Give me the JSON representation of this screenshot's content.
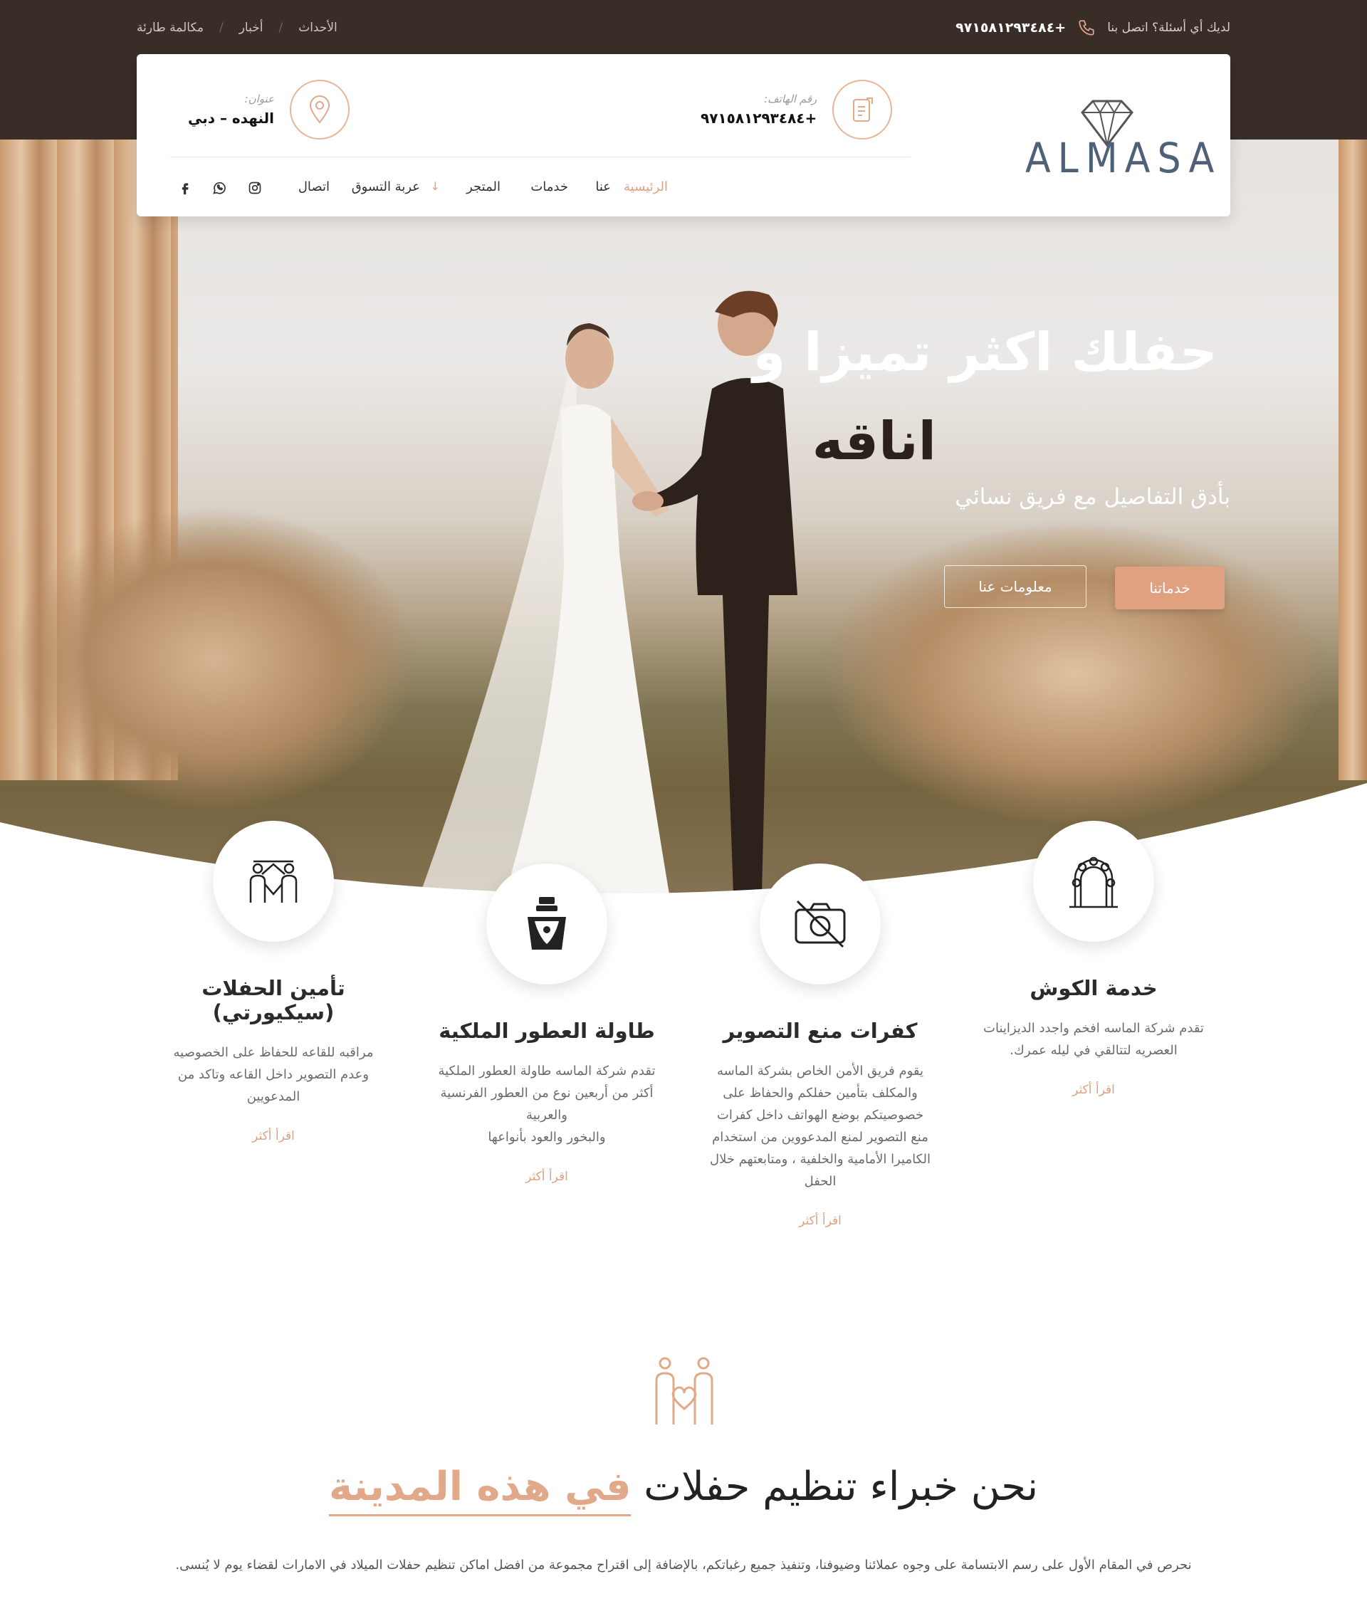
{
  "topbar": {
    "contact_label": "لديك أي أسئلة؟ اتصل بنا",
    "phone": "+٩٧١٥٨١٢٩٣٤٨٤",
    "links": [
      "الأحداث",
      "أخبار",
      "مكالمة طارئة"
    ]
  },
  "header": {
    "brand": "ALMASA",
    "phone_label": "رقم الهاتف:",
    "phone": "+٩٧١٥٨١٢٩٣٤٨٤",
    "address_label": "عنوان:",
    "address": "النهده – دبي",
    "nav": [
      "الرئيسية",
      "عنا",
      "خدمات",
      "المتجر",
      "عربة التسوق",
      "اتصال"
    ],
    "social_icons": [
      "instagram-icon",
      "whatsapp-icon",
      "facebook-icon"
    ]
  },
  "hero": {
    "title_line1": "حفلك اكثر تميزا و",
    "title_line2": "اناقه",
    "subtitle": "بأدق التفاصيل مع فريق نسائي",
    "primary_button": "خدماتنا",
    "secondary_button": "معلومات عنا"
  },
  "services": [
    {
      "title": "خدمة الكوش",
      "text": "تقدم شركة الماسه افخم واجدد الديزاينات\nالعصريه لتتالقي في ليله عمرك.",
      "link": "اقرأ أكثر"
    },
    {
      "title": "كفرات منع التصوير",
      "text": "يقوم فريق الأمن الخاص بشركة الماسه\nوالمكلف بتأمين حفلكم والحفاظ على\nخصوصيتكم بوضع الهواتف داخل كفرات\nمنع التصوير لمنع المدعووين من استخدام\nالكاميرا الأمامية والخلفية ، ومتابعتهم خلال\nالحفل",
      "link": "اقرأ أكثر"
    },
    {
      "title": "طاولة العطور الملكية",
      "text": "تقدم شركة الماسه طاولة العطور الملكية\nأكثر من أربعين نوع من العطور الفرنسية\nوالعربية\nوالبخور والعود بأنواعها",
      "link": "اقرأ أكثر"
    },
    {
      "title": "تأمين الحفلات (سيكيورتي)",
      "text": "مراقبه للقاعه للحفاظ على الخصوصيه\nوعدم التصوير داخل القاعه وتاكد من\nالمدعويين",
      "link": "اقرأ أكثر"
    }
  ],
  "about": {
    "title_plain": "نحن خبراء تنظيم حفلات ",
    "title_highlight": "في هذه المدينة",
    "text": "نحرص في المقام الأول على رسم الابتسامة على وجوه عملائنا وضيوفنا، وتنفيذ جميع رغباتكم، بالإضافة إلى اقتراح مجموعة من افضل اماكن تنظيم حفلات الميلاد في الامارات لقضاء يوم لا يُنسى."
  },
  "colors": {
    "accent": "#dfa180",
    "dark": "#382d27",
    "brand": "#4e6178"
  }
}
